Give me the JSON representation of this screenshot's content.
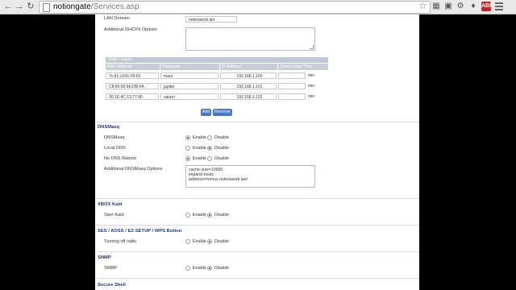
{
  "browser": {
    "url_host": "notiongate",
    "url_path": "/Services.asp"
  },
  "dhcp": {
    "lan_domain_label": "LAN Domain",
    "lan_domain_value": "notionwork.lan",
    "dhcpd_options_label": "Additional DHCPd Options",
    "static_leases": {
      "title": "Static Leases",
      "columns": [
        "MAC Address",
        "Hostname",
        "IP Address",
        "Client Lease Time"
      ],
      "unit": "min",
      "rows": [
        {
          "mac": "7c:d1:c3:6c:09:62",
          "host": "mars",
          "ip": "192.168.1.100",
          "lease": ""
        },
        {
          "mac": "C8:60:00:9E:DB:FA",
          "host": "jupiter",
          "ip": "192.168.1.101",
          "lease": ""
        },
        {
          "mac": "00:1E:4C:13:77:90",
          "host": "saturn",
          "ip": "192.168.1.102",
          "lease": ""
        }
      ]
    },
    "add_label": "Add",
    "remove_label": "Remove"
  },
  "radio_labels": {
    "enable": "Enable",
    "disable": "Disable"
  },
  "dnsmasq": {
    "title": "DNSMasq",
    "rows": [
      {
        "label": "DNSMasq",
        "value": "enable"
      },
      {
        "label": "Local DNS",
        "value": "disable"
      },
      {
        "label": "No DNS Rebind",
        "value": "enable"
      }
    ],
    "options_label": "Additional DNSMasq Options",
    "options_text": "cache-size=10000\nexpand-hosts\naddress=/venus.notionwork.lan/"
  },
  "xbox": {
    "title": "XBOX Kaid",
    "row_label": "Start Kaid",
    "value": "disable"
  },
  "ses": {
    "title": "SES / AOSS / EZ-SETUP / WPS Button",
    "row_label": "Turning off radio",
    "value": "disable"
  },
  "snmp": {
    "title": "SNMP",
    "row_label": "SNMP",
    "value": "disable"
  },
  "ssh": {
    "title": "Secure Shell"
  }
}
